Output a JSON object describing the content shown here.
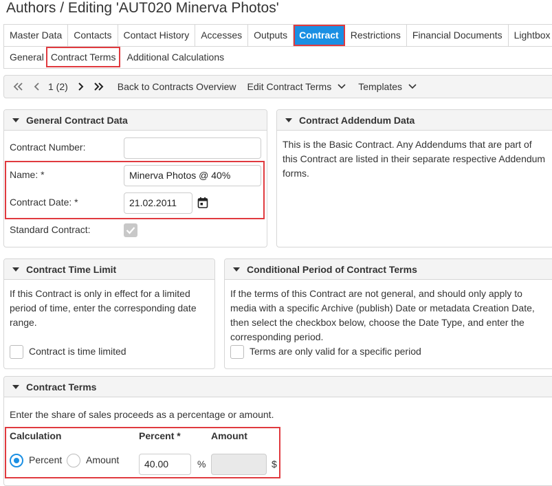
{
  "page": {
    "title": "Authors / Editing 'AUT020 Minerva Photos'"
  },
  "main_tabs": [
    {
      "label": "Master Data"
    },
    {
      "label": "Contacts"
    },
    {
      "label": "Contact History"
    },
    {
      "label": "Accesses"
    },
    {
      "label": "Outputs"
    },
    {
      "label": "Contract"
    },
    {
      "label": "Restrictions"
    },
    {
      "label": "Financial Documents"
    },
    {
      "label": "Lightbox"
    }
  ],
  "sub_tabs": [
    {
      "label": "General"
    },
    {
      "label": "Contract Terms"
    },
    {
      "label": "Additional Calculations"
    }
  ],
  "toolbar": {
    "pager": "1 (2)",
    "back_label": "Back to Contracts Overview",
    "edit_terms_label": "Edit Contract Terms",
    "templates_label": "Templates"
  },
  "general_contract": {
    "header": "General Contract Data",
    "contract_number_label": "Contract Number:",
    "contract_number_value": "",
    "name_label": "Name: *",
    "name_value": "Minerva Photos @ 40%",
    "date_label": "Contract Date: *",
    "date_value": "21.02.2011",
    "standard_label": "Standard Contract:"
  },
  "addendum": {
    "header": "Contract Addendum Data",
    "text": "This is the Basic Contract. Any Addendums that are part of this Contract are listed in their separate respective Addendum forms."
  },
  "time_limit": {
    "header": "Contract Time Limit",
    "text": "If this Contract is only in effect for a limited period of time, enter the corresponding date range.",
    "checkbox_label": "Contract is time limited"
  },
  "conditional": {
    "header": "Conditional Period of Contract Terms",
    "text": "If the terms of this Contract are not general, and should only apply to media with a specific Archive (publish) Date or metadata Creation Date, then select the checkbox below, choose the Date Type, and enter the corresponding period.",
    "checkbox_label": "Terms are only valid for a specific period"
  },
  "contract_terms": {
    "header": "Contract Terms",
    "intro": "Enter the share of sales proceeds as a percentage or amount.",
    "calc_header": "Calculation",
    "percent_header": "Percent *",
    "amount_header": "Amount",
    "radio_percent": "Percent",
    "radio_amount": "Amount",
    "percent_value": "40.00",
    "percent_unit": "%",
    "amount_value": "",
    "amount_unit": "$"
  },
  "colors": {
    "accent": "#1a8fe3",
    "highlight": "#e0393e"
  }
}
